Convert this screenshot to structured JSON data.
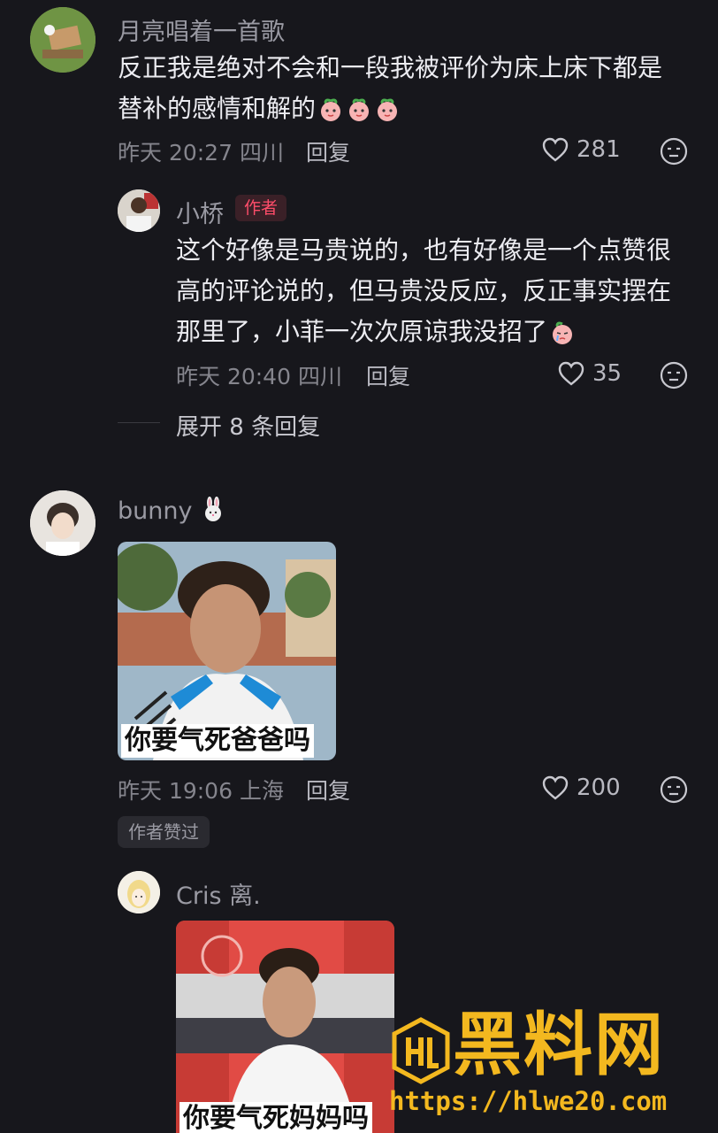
{
  "comments": [
    {
      "username": "月亮唱着一首歌",
      "text_line1": "反正我是绝对不会和一段我被评价为床上床下都是",
      "text_line2": "替补的感情和解的",
      "time": "昨天 20:27 四川",
      "reply_label": "回复",
      "likes": "281",
      "reply": {
        "username": "小桥",
        "badge": "作者",
        "text_line1": "这个好像是马贵说的，也有好像是一个点赞很",
        "text_line2": "高的评论说的，但马贵没反应，反正事实摆在",
        "text_line3": "那里了，小菲一次次原谅我没招了",
        "time": "昨天 20:40 四川",
        "reply_label": "回复",
        "likes": "35"
      },
      "expand_label": "展开 8 条回复"
    },
    {
      "username": "bunny",
      "image_caption": "你要气死爸爸吗",
      "time": "昨天 19:06 上海",
      "reply_label": "回复",
      "likes": "200",
      "author_liked": "作者赞过",
      "reply": {
        "username": "Cris 离.",
        "image_caption": "你要气死妈妈吗"
      }
    }
  ],
  "watermark": {
    "brand": "黑料网",
    "url": "https://hlwe20.com",
    "color": "#f3b81f"
  },
  "colors": {
    "background": "#17171c",
    "author_badge": "#ff4d6a"
  }
}
